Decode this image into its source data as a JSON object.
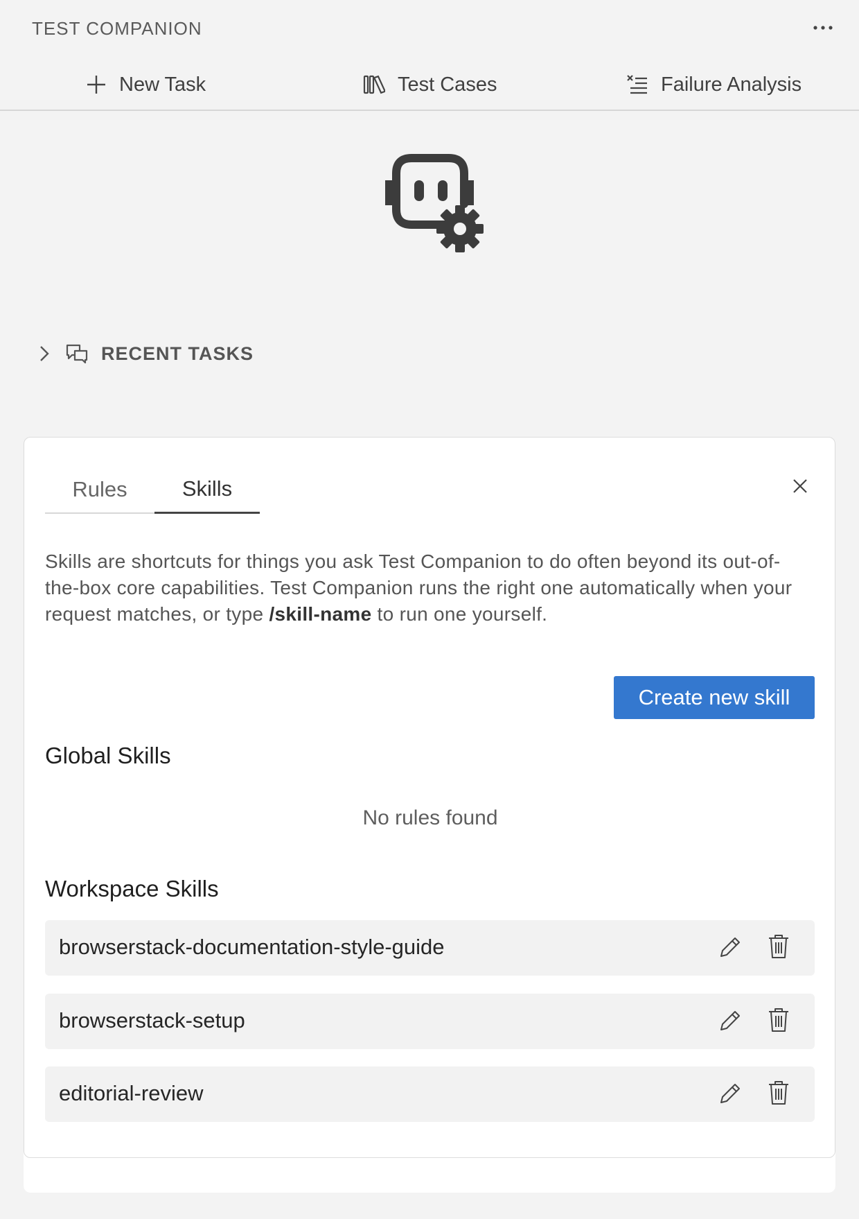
{
  "header": {
    "title": "TEST COMPANION",
    "more_icon": "more-horizontal-icon"
  },
  "nav": {
    "new_task": "New Task",
    "test_cases": "Test Cases",
    "failure_analysis": "Failure Analysis"
  },
  "logo_icon": "bot-gear-icon",
  "recent": {
    "label": "RECENT TASKS"
  },
  "panel": {
    "tabs": [
      {
        "label": "Rules",
        "active": false
      },
      {
        "label": "Skills",
        "active": true
      }
    ],
    "description_before": "Skills are shortcuts for things you ask Test Companion to do often beyond its out-of-the-box core capabilities. Test Companion runs the right one automatically when your request matches, or type ",
    "description_command": "/skill-name",
    "description_after": " to run one yourself.",
    "create_button": "Create new skill",
    "global_title": "Global Skills",
    "global_empty": "No rules found",
    "workspace_title": "Workspace Skills",
    "skills": [
      {
        "name": "browserstack-documentation-style-guide"
      },
      {
        "name": "browserstack-setup"
      },
      {
        "name": "editorial-review"
      }
    ]
  },
  "colors": {
    "accent": "#3478cf",
    "background": "#f3f3f3",
    "panel": "#ffffff",
    "row": "#f2f2f2"
  }
}
